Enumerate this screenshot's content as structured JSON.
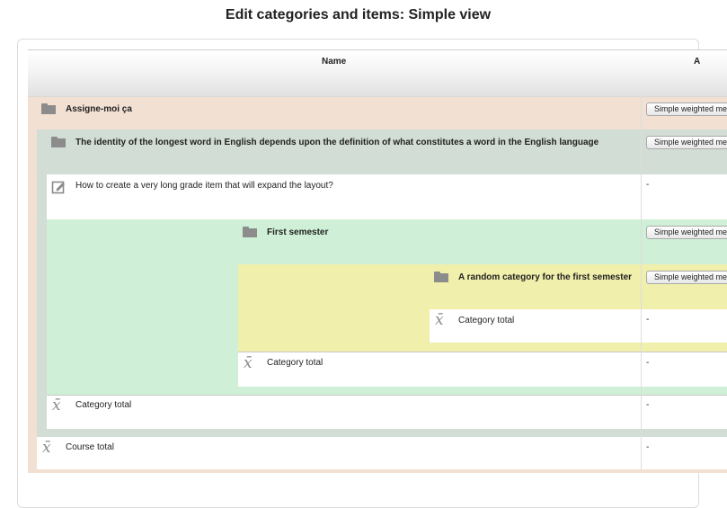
{
  "page": {
    "title": "Edit categories and items: Simple view"
  },
  "table": {
    "headers": {
      "name": "Name",
      "next_col_fragment": "A"
    },
    "rows": {
      "cat_root": {
        "label": "Assigne-moi ça",
        "button": "Simple weighted mean of grades"
      },
      "cat_long": {
        "label": "The identity of the longest word in English depends upon the definition of what constitutes a word in the English language",
        "button": "Simple weighted mean of grades"
      },
      "item_long": {
        "label": "How to create a very long grade item that will expand the layout?",
        "value": "-"
      },
      "cat_first": {
        "label": "First semester",
        "button": "Simple weighted mean of grades"
      },
      "cat_random": {
        "label": "A random category for the first semester",
        "button": "Simple weighted mean of grades"
      },
      "total_random": {
        "label": "Category total",
        "value": "-"
      },
      "total_first": {
        "label": "Category total",
        "value": "-"
      },
      "total_long": {
        "label": "Category total",
        "value": "-"
      },
      "course_total": {
        "label": "Course total",
        "value": "-"
      }
    }
  },
  "colors": {
    "root_category": "#f2e0d2",
    "level2_category": "#d2ddd5",
    "level3_category": "#cff0d6",
    "level4_category": "#f0efab",
    "item_row": "#ffffff"
  },
  "icons": {
    "category": "folder-icon",
    "grade_item": "edit-item-icon",
    "total": "mean-x-bar-icon"
  }
}
